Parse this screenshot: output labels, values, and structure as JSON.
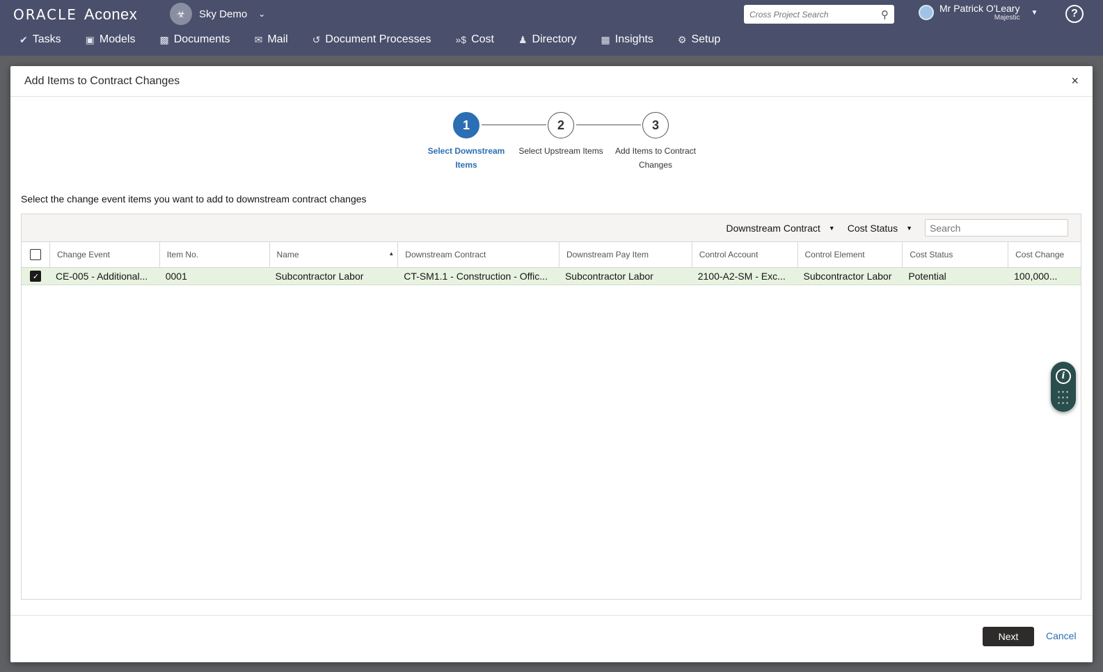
{
  "header": {
    "logo_oracle": "ORACLE",
    "logo_product": "Aconex",
    "project_name": "Sky Demo",
    "cross_search_placeholder": "Cross Project Search",
    "user_name": "Mr Patrick O'Leary",
    "user_org": "Majestic",
    "help_label": "?"
  },
  "nav": [
    {
      "label": "Tasks",
      "icon": "check-icon"
    },
    {
      "label": "Models",
      "icon": "cube-icon"
    },
    {
      "label": "Documents",
      "icon": "document-icon"
    },
    {
      "label": "Mail",
      "icon": "mail-icon"
    },
    {
      "label": "Document Processes",
      "icon": "workflow-icon"
    },
    {
      "label": "Cost",
      "icon": "cost-icon"
    },
    {
      "label": "Directory",
      "icon": "people-icon"
    },
    {
      "label": "Insights",
      "icon": "bar-chart-icon"
    },
    {
      "label": "Setup",
      "icon": "gear-icon"
    }
  ],
  "modal": {
    "title": "Add Items to Contract Changes",
    "close": "×",
    "steps": [
      {
        "number": "1",
        "label": "Select Downstream Items",
        "active": true
      },
      {
        "number": "2",
        "label": "Select Upstream Items",
        "active": false
      },
      {
        "number": "3",
        "label": "Add Items to Contract Changes",
        "active": false
      }
    ],
    "instruction": "Select the change event items you want to add to downstream contract changes",
    "toolbar": {
      "filter_downstream": "Downstream Contract",
      "filter_cost_status": "Cost Status",
      "search_placeholder": "Search"
    },
    "columns": [
      "Change Event",
      "Item No.",
      "Name",
      "Downstream Contract",
      "Downstream Pay Item",
      "Control Account",
      "Control Element",
      "Cost Status",
      "Cost Change"
    ],
    "rows": [
      {
        "checked": true,
        "cells": [
          "CE-005 - Additional...",
          "0001",
          "Subcontractor Labor",
          "CT-SM1.1 - Construction - Offic...",
          "Subcontractor Labor",
          "2100-A2-SM - Exc...",
          "Subcontractor Labor",
          "Potential",
          "100,000..."
        ]
      }
    ],
    "footer": {
      "next_label": "Next",
      "cancel_label": "Cancel"
    }
  }
}
